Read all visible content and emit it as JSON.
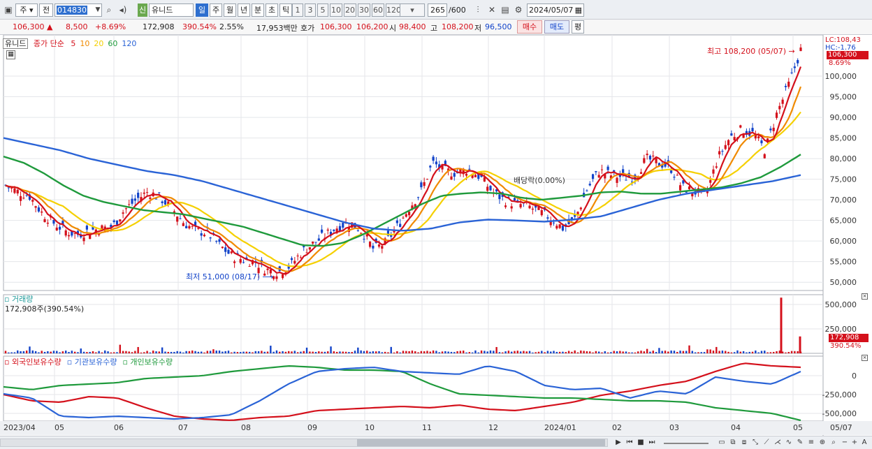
{
  "toolbar": {
    "period_type": "주",
    "period_full": "전",
    "code": "014830",
    "sin_tag": "신",
    "name": "유니드",
    "periods": [
      "일",
      "주",
      "월",
      "년",
      "분",
      "초",
      "틱"
    ],
    "selected_period": "일",
    "intervals": [
      "1",
      "3",
      "5",
      "10",
      "20",
      "30",
      "60",
      "120"
    ],
    "count": "265",
    "count_max": "/600",
    "date": "2024/05/07"
  },
  "quote": {
    "price": "106,300",
    "arrow": "▲",
    "change": "8,500",
    "change_pct": "+8.69%",
    "volume": "172,908",
    "volume_pct": "390.54%",
    "turnover_pct": "2.55%",
    "amount": "17,953백만",
    "hoga_label": "호가",
    "ask": "106,300",
    "bid": "106,200",
    "open_label": "시",
    "open": "98,400",
    "high_label": "고",
    "high": "108,200",
    "low_label": "저",
    "low": "96,500",
    "buy_label": "매수",
    "sell_label": "매도",
    "eval_label": "평"
  },
  "legend": {
    "name": "유니드",
    "title": "종가 단순",
    "ma": [
      {
        "label": "5",
        "color": "#d4101b"
      },
      {
        "label": "10",
        "color": "#f08a00"
      },
      {
        "label": "20",
        "color": "#f5d000"
      },
      {
        "label": "60",
        "color": "#1f9a3c"
      },
      {
        "label": "120",
        "color": "#2a63d6"
      }
    ]
  },
  "annotations": {
    "high": "최고 108,200 (05/07)",
    "low": "최저 51,000 (08/17)",
    "dividend": "배당락(0.00%)",
    "lc": "LC:108,43",
    "hc": "HC:-1.76",
    "last_price": "106,300",
    "last_pct": "8.69%"
  },
  "volume_panel": {
    "title": "거래량",
    "value": "172,908주(390.54%)",
    "last": "172,908",
    "last_pct": "390.54%",
    "ticks": [
      "500,000",
      "250,000"
    ]
  },
  "holder_panel": {
    "labels": [
      {
        "text": "외국인보유수량",
        "color": "#d4101b"
      },
      {
        "text": "기관보유수량",
        "color": "#2a63d6"
      },
      {
        "text": "개인보유수량",
        "color": "#1f9a3c"
      }
    ],
    "ticks": [
      "0",
      "-250,000",
      "-500,000"
    ]
  },
  "colors": {
    "up": "#d4101b",
    "down": "#1243c9",
    "grid": "#e4e6ea"
  },
  "chart_data": {
    "type": "candlestick",
    "price_axis": [
      "100,000",
      "95,000",
      "90,000",
      "85,000",
      "80,000",
      "75,000",
      "70,000",
      "65,000",
      "60,000",
      "55,000",
      "50,000"
    ],
    "x_labels": [
      "2023/04",
      "05",
      "06",
      "07",
      "08",
      "09",
      "10",
      "11",
      "12",
      "2024/01",
      "02",
      "03",
      "04",
      "05",
      "05/07"
    ],
    "ylim": [
      48000,
      110000
    ],
    "close_path": [
      73500,
      72000,
      71000,
      67000,
      64500,
      62500,
      61500,
      62500,
      63000,
      63500,
      67500,
      70000,
      72000,
      70500,
      68000,
      64500,
      62500,
      62000,
      59000,
      56500,
      55500,
      55000,
      53000,
      52500,
      54000,
      57500,
      59500,
      61500,
      63500,
      64500,
      62500,
      58000,
      59500,
      63500,
      68000,
      72000,
      79000,
      77000,
      76500,
      77500,
      75500,
      72000,
      70000,
      69000,
      68500,
      67000,
      65500,
      63000,
      65500,
      72500,
      77000,
      76000,
      75500,
      75500,
      80000,
      79000,
      78000,
      73000,
      72000,
      71000,
      80000,
      85000,
      87000,
      86000,
      82000,
      91000,
      98000,
      106300
    ],
    "ma60_path": [
      80500,
      79000,
      76500,
      73500,
      71000,
      69500,
      68500,
      67500,
      67000,
      66500,
      65500,
      64500,
      63500,
      62000,
      60500,
      59000,
      58800,
      59500,
      61500,
      64000,
      66500,
      69000,
      71000,
      71500,
      71800,
      71500,
      70500,
      70000,
      70500,
      71000,
      71800,
      72000,
      71500,
      71500,
      72000,
      72500,
      73000,
      74000,
      75500,
      78000,
      81000
    ],
    "ma120_path": [
      85000,
      83500,
      82000,
      80000,
      78500,
      77000,
      76000,
      74500,
      72500,
      70500,
      68500,
      66500,
      64500,
      63000,
      62500,
      63000,
      64500,
      65200,
      65000,
      64700,
      65200,
      66000,
      68000,
      70000,
      71500,
      72500,
      73500,
      74500,
      76000
    ],
    "volume_spikes": [
      {
        "date": "2024/05/02",
        "value": 570000
      },
      {
        "date": "2024/05/07",
        "value": 172908
      }
    ],
    "volume_ylim": [
      0,
      600000
    ]
  }
}
